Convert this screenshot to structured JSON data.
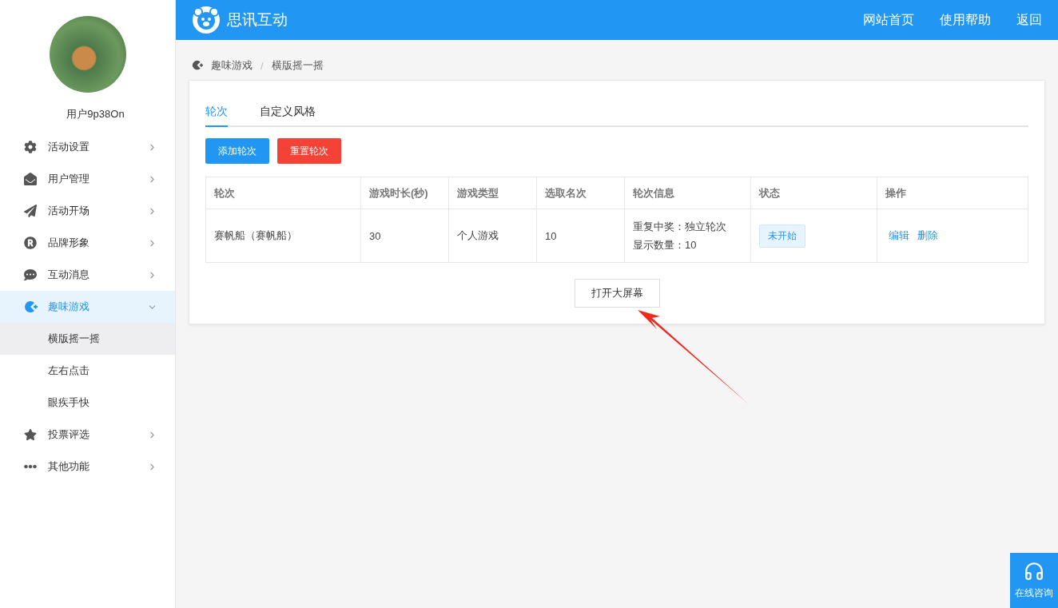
{
  "sidebar": {
    "username": "用户9p38On",
    "menu": [
      {
        "label": "活动设置",
        "expanded": false
      },
      {
        "label": "用户管理",
        "expanded": false
      },
      {
        "label": "活动开场",
        "expanded": false
      },
      {
        "label": "品牌形象",
        "expanded": false
      },
      {
        "label": "互动消息",
        "expanded": false
      },
      {
        "label": "趣味游戏",
        "expanded": true,
        "children": [
          {
            "label": "横版摇一摇",
            "selected": true
          },
          {
            "label": "左右点击",
            "selected": false
          },
          {
            "label": "眼疾手快",
            "selected": false
          }
        ]
      },
      {
        "label": "投票评选",
        "expanded": false
      },
      {
        "label": "其他功能",
        "expanded": false
      }
    ]
  },
  "header": {
    "brand": "思讯互动",
    "links": [
      "网站首页",
      "使用帮助",
      "返回"
    ]
  },
  "breadcrumb": [
    "趣味游戏",
    "/",
    "横版摇一摇"
  ],
  "tabs": [
    {
      "label": "轮次",
      "selected": true
    },
    {
      "label": "自定义风格",
      "selected": false
    }
  ],
  "buttons": [
    {
      "label": "添加轮次",
      "kind": "primary"
    },
    {
      "label": "重置轮次",
      "kind": "danger"
    }
  ],
  "table": {
    "columns": [
      "轮次",
      "游戏时长(秒)",
      "游戏类型",
      "选取名次",
      "轮次信息",
      "状态",
      "操作"
    ],
    "rows": [
      {
        "cells": [
          "赛帆船（赛帆船）",
          "30",
          "个人游戏",
          "10"
        ],
        "info": [
          "重复中奖：独立轮次",
          "显示数量：10"
        ],
        "status": "未开始",
        "actions": [
          "编辑",
          "删除"
        ]
      }
    ]
  },
  "open_button": "打开大屏幕",
  "support": {
    "label": "在线咨询"
  }
}
